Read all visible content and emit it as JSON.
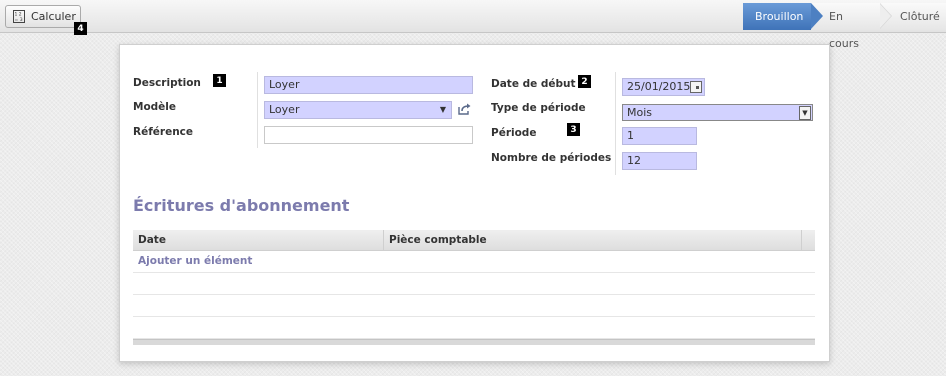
{
  "toolbar": {
    "calculate_label": "Calculer",
    "calculate_icon": "calculator-icon"
  },
  "statusbar": {
    "steps": [
      {
        "label": "Brouillon",
        "active": true
      },
      {
        "label": "En cours",
        "active": false
      },
      {
        "label": "Clôturé",
        "active": false
      }
    ],
    "active_color": "#4a7cc0"
  },
  "badges": [
    "1",
    "2",
    "3",
    "4"
  ],
  "form": {
    "description": {
      "label": "Description",
      "value": "Loyer"
    },
    "model": {
      "label": "Modèle",
      "value": "Loyer",
      "external_link_icon": "external-link-icon"
    },
    "reference": {
      "label": "Référence",
      "value": ""
    },
    "start_date": {
      "label": "Date de début",
      "value": "25/01/2015",
      "icon": "calendar-icon"
    },
    "period_type": {
      "label": "Type de période",
      "value": "Mois"
    },
    "period": {
      "label": "Période",
      "value": "1"
    },
    "num_periods": {
      "label": "Nombre de périodes",
      "value": "12"
    },
    "required_color": "#d2d2ff"
  },
  "entries": {
    "title": "Écritures d'abonnement",
    "columns": [
      "Date",
      "Pièce comptable"
    ],
    "add_item_label": "Ajouter un élément"
  }
}
